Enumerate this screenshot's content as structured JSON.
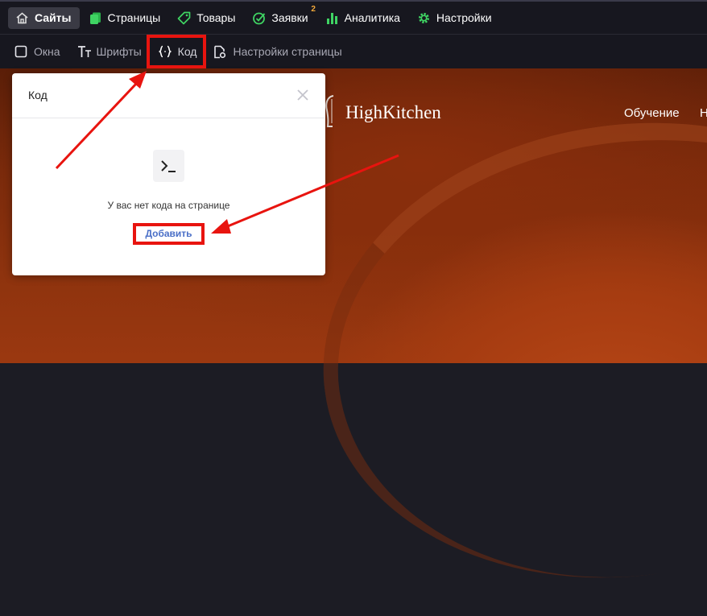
{
  "topnav": {
    "items": [
      {
        "label": "Сайты",
        "icon": "home-icon"
      },
      {
        "label": "Страницы",
        "icon": "pages-icon"
      },
      {
        "label": "Товары",
        "icon": "tag-icon"
      },
      {
        "label": "Заявки",
        "icon": "requests-icon",
        "badge": "2"
      },
      {
        "label": "Аналитика",
        "icon": "analytics-icon"
      },
      {
        "label": "Настройки",
        "icon": "gear-icon"
      }
    ]
  },
  "subnav": {
    "items": [
      {
        "label": "Окна",
        "icon": "window-icon"
      },
      {
        "label": "Шрифты",
        "icon": "fonts-icon"
      },
      {
        "label": "Код",
        "icon": "code-braces-icon"
      },
      {
        "label": "Настройки страницы",
        "icon": "page-settings-icon"
      }
    ]
  },
  "hero": {
    "brand": "HighKitchen",
    "menu": [
      "Обучение",
      "Н"
    ]
  },
  "popup": {
    "title": "Код",
    "empty_text": "У вас нет кода на странице",
    "add_label": "Добавить",
    "code_icon": ">_"
  },
  "colors": {
    "nav_bg": "#17171f",
    "highlight": "#e8140f",
    "link": "#4a6fc7",
    "badge": "#f3a93a"
  }
}
